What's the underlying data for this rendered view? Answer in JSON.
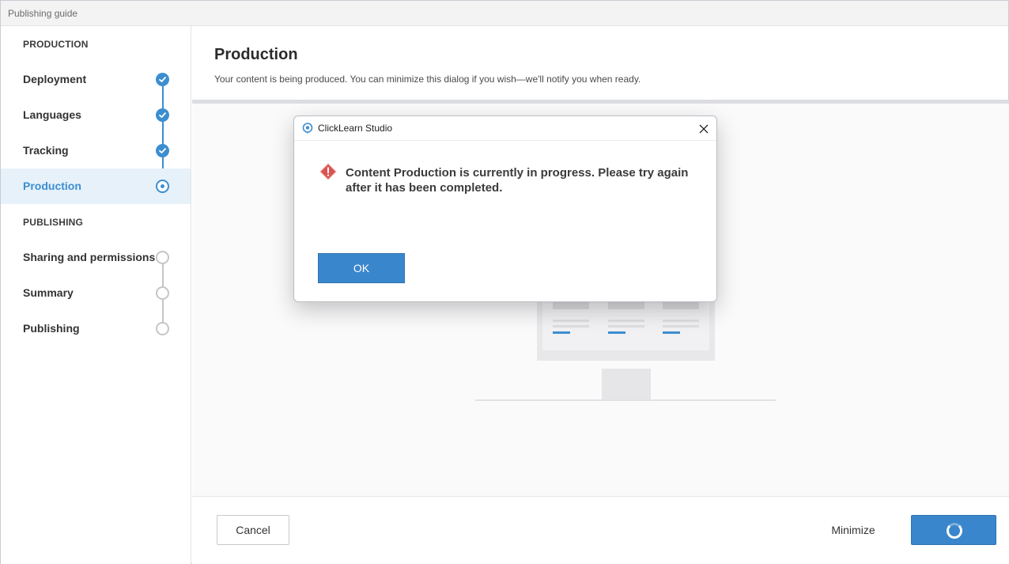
{
  "window": {
    "title": "Publishing guide"
  },
  "sidebar": {
    "sections": [
      {
        "label": "PRODUCTION"
      },
      {
        "label": "PUBLISHING"
      }
    ],
    "steps": [
      {
        "label": "Deployment",
        "status": "done"
      },
      {
        "label": "Languages",
        "status": "done"
      },
      {
        "label": "Tracking",
        "status": "done"
      },
      {
        "label": "Production",
        "status": "current"
      },
      {
        "label": "Sharing and permissions",
        "status": "pending"
      },
      {
        "label": "Summary",
        "status": "pending"
      },
      {
        "label": "Publishing",
        "status": "pending"
      }
    ]
  },
  "main": {
    "title": "Production",
    "subtitle": "Your content is being produced. You can minimize this dialog if you wish—we'll notify you when ready."
  },
  "footer": {
    "cancel_label": "Cancel",
    "minimize_label": "Minimize"
  },
  "modal": {
    "title": "ClickLearn Studio",
    "message": "Content Production is currently in progress. Please try again after it has been completed.",
    "ok_label": "OK"
  },
  "colors": {
    "accent": "#3a86cc",
    "active_bg": "#e6f1fa",
    "warning": "#d9534f"
  }
}
